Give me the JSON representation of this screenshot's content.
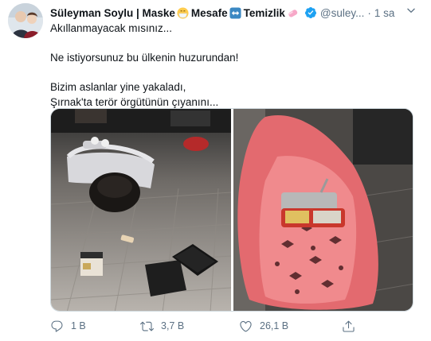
{
  "tweet": {
    "author_name": "Süleyman Soylu | Maske",
    "name_part2": "Mesafe",
    "name_part3": "Temizlik",
    "handle": "@suley...",
    "separator": "·",
    "time": "1 sa",
    "lines": [
      "Akıllanmayacak mısınız...",
      "Ne istiyorsunuz bu ülkenin huzurundan!",
      "Bizim aslanlar yine yakaladı,",
      "Şırnak'ta terör örgütünün çıyanını..."
    ]
  },
  "actions": {
    "reply_count": "1 B",
    "retweet_count": "3,7 B",
    "like_count": "26,1 B"
  },
  "icons": {
    "more": "chevron-down-icon",
    "verified": "verified-badge-icon",
    "reply": "reply-icon",
    "retweet": "retweet-icon",
    "like": "heart-icon",
    "share": "share-icon"
  },
  "colors": {
    "text": "#0f1419",
    "secondary": "#5b7083",
    "verified": "#1da1f2",
    "border": "#cfd9de"
  }
}
